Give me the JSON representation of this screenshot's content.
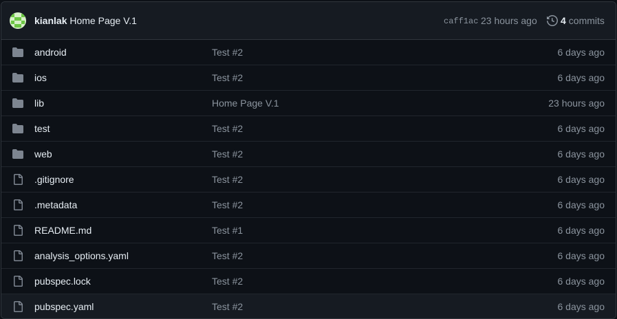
{
  "header": {
    "author": "kianlak",
    "message": "Home Page V.1",
    "sha": "caff1ac",
    "time": "23 hours ago",
    "commits_count": "4",
    "commits_label": "commits",
    "history_icon": "history-icon",
    "avatar_icon": "identicon-avatar"
  },
  "files": [
    {
      "name": "android",
      "type": "folder",
      "message": "Test #2",
      "age": "6 days ago"
    },
    {
      "name": "ios",
      "type": "folder",
      "message": "Test #2",
      "age": "6 days ago"
    },
    {
      "name": "lib",
      "type": "folder",
      "message": "Home Page V.1",
      "age": "23 hours ago"
    },
    {
      "name": "test",
      "type": "folder",
      "message": "Test #2",
      "age": "6 days ago"
    },
    {
      "name": "web",
      "type": "folder",
      "message": "Test #2",
      "age": "6 days ago"
    },
    {
      "name": ".gitignore",
      "type": "file",
      "message": "Test #2",
      "age": "6 days ago"
    },
    {
      "name": ".metadata",
      "type": "file",
      "message": "Test #2",
      "age": "6 days ago"
    },
    {
      "name": "README.md",
      "type": "file",
      "message": "Test #1",
      "age": "6 days ago"
    },
    {
      "name": "analysis_options.yaml",
      "type": "file",
      "message": "Test #2",
      "age": "6 days ago"
    },
    {
      "name": "pubspec.lock",
      "type": "file",
      "message": "Test #2",
      "age": "6 days ago"
    },
    {
      "name": "pubspec.yaml",
      "type": "file",
      "message": "Test #2",
      "age": "6 days ago"
    }
  ],
  "colors": {
    "background": "#0d1117",
    "header_bg": "#161b22",
    "border": "#30363d",
    "text": "#e6edf3",
    "muted": "#8b949e",
    "icon": "#7d8590",
    "avatar_green": "#6cc644"
  }
}
